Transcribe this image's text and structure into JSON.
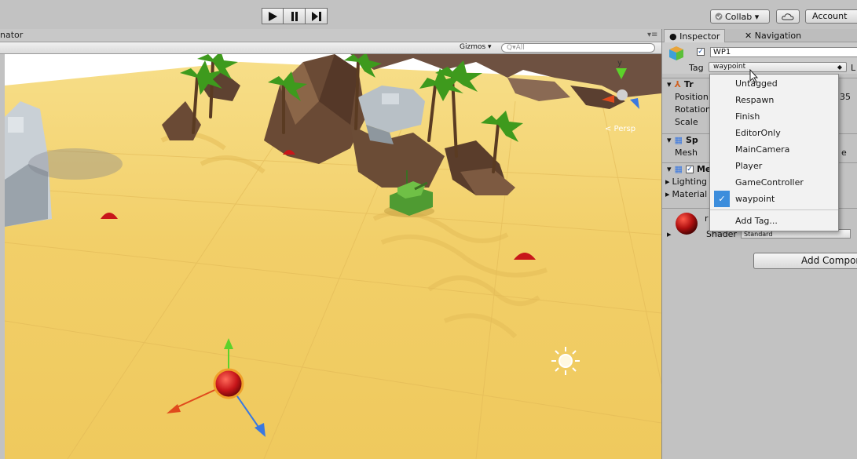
{
  "toolbar": {
    "collab_label": "Collab ▾",
    "account_label": "Account"
  },
  "scene": {
    "tab_label": "nator",
    "gizmos_label": "Gizmos ▾",
    "search_placeholder": "Q▾All",
    "persp_label": "< Persp",
    "gizmo_axis_y": "y"
  },
  "inspector": {
    "tabs": [
      {
        "label": "Inspector",
        "icon": "info-icon"
      },
      {
        "label": "Navigation",
        "icon": "navigation-icon"
      }
    ],
    "object_name": "WP1",
    "tag_label": "Tag",
    "tag_value": "waypoint",
    "layer_cut": "L",
    "transform": {
      "header": "Tr",
      "props": [
        "Position",
        "Rotation",
        "Scale"
      ],
      "position_tail": "35"
    },
    "sphere": {
      "header": "Sp",
      "prop": "Mesh",
      "prop_tail": "e"
    },
    "mesh_renderer": {
      "header": "Me",
      "folds": [
        "Lighting",
        "Material"
      ]
    },
    "material": {
      "name_cut": "r",
      "shader_label": "Shader",
      "shader_value": "Standard"
    },
    "add_component_label": "Add Compor"
  },
  "tag_dropdown": {
    "items": [
      "Untagged",
      "Respawn",
      "Finish",
      "EditorOnly",
      "MainCamera",
      "Player",
      "GameController",
      "waypoint"
    ],
    "selected": "waypoint",
    "add_tag_label": "Add Tag..."
  },
  "colors": {
    "sand": "#f0cd63",
    "sky": "#ffffff",
    "waypoint_red": "#c8161a",
    "palm_green": "#3e9a1d",
    "rock_brown": "#6a4a35",
    "selection_blue": "#3c8ddc"
  }
}
